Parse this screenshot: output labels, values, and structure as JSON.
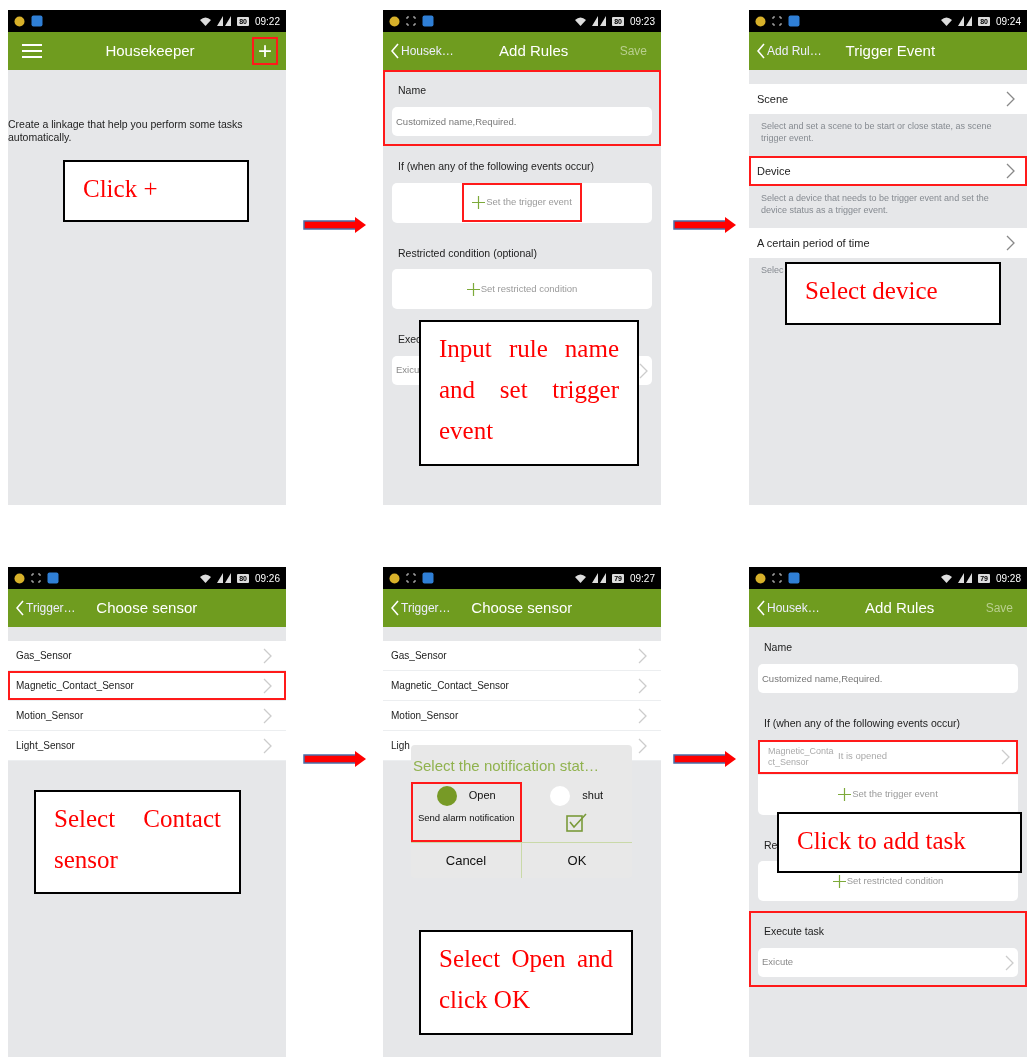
{
  "steps": [
    {
      "status": {
        "time": "09:22",
        "battery": "80"
      },
      "appbar": {
        "menu": true,
        "title": "Housekeeper",
        "action": {
          "label": "+",
          "disabled": false,
          "highlighted": true
        }
      },
      "kind": "intro",
      "text": "Create a linkage that help you perform some tasks automatically.",
      "callout": "Click +"
    },
    {
      "status": {
        "time": "09:23",
        "battery": "80"
      },
      "appbar": {
        "back": "Housek…",
        "title": "Add Rules",
        "action": {
          "label": "Save",
          "disabled": true,
          "highlighted": false
        }
      },
      "kind": "form",
      "sections": [
        {
          "label": "Name",
          "kind": "input",
          "placeholder": "Customized name,Required.",
          "highlighted": true
        },
        {
          "label": "If (when any of the following events occur)",
          "kind": "add",
          "button": {
            "label": "Set the trigger event",
            "highlighted": true
          },
          "highlighted": false
        },
        {
          "label": "Restricted condition (optional)",
          "kind": "add",
          "button": {
            "label": "Set restricted condition",
            "highlighted": false
          },
          "highlighted": false
        },
        {
          "label": "Exec",
          "kind": "select",
          "placeholder": "Exicu",
          "highlighted": false
        }
      ],
      "callout": "Input rule name and set trigger event"
    },
    {
      "status": {
        "time": "09:24",
        "battery": "80"
      },
      "appbar": {
        "back": "Add Rul…",
        "title": "Trigger Event"
      },
      "kind": "options",
      "options": [
        {
          "label": "Scene",
          "description": "Select and set a scene to be start or close state, as scene trigger event.",
          "highlighted": false
        },
        {
          "label": "Device",
          "description": "Select a device that needs to be trigger event and set the device status as a trigger event.",
          "highlighted": true
        },
        {
          "label": "A certain period of time",
          "description": "Selec",
          "highlighted": false
        }
      ],
      "callout": "Select device"
    },
    {
      "status": {
        "time": "09:26",
        "battery": "80"
      },
      "appbar": {
        "back": "Trigger…",
        "title": "Choose sensor"
      },
      "kind": "list",
      "items": [
        {
          "label": "Gas_Sensor",
          "highlighted": false
        },
        {
          "label": "Magnetic_Contact_Sensor",
          "highlighted": true
        },
        {
          "label": "Motion_Sensor",
          "highlighted": false
        },
        {
          "label": "Light_Sensor",
          "highlighted": false
        }
      ],
      "callout": "Select Contact sensor"
    },
    {
      "status": {
        "time": "09:27",
        "battery": "79"
      },
      "appbar": {
        "back": "Trigger…",
        "title": "Choose sensor"
      },
      "kind": "list",
      "items": [
        {
          "label": "Gas_Sensor",
          "highlighted": false
        },
        {
          "label": "Magnetic_Contact_Sensor",
          "highlighted": false
        },
        {
          "label": "Motion_Sensor",
          "highlighted": false
        },
        {
          "label": "Ligh",
          "highlighted": false
        }
      ],
      "dialog": {
        "title": "Select the notification stat…",
        "options": [
          {
            "label": "Open",
            "selected": true,
            "note": "Send alarm notification",
            "highlighted": true
          },
          {
            "label": "shut",
            "selected": false,
            "checked": true,
            "highlighted": false
          }
        ],
        "buttons": [
          "Cancel",
          "OK"
        ]
      },
      "callout": "Select Open and click OK"
    },
    {
      "status": {
        "time": "09:28",
        "battery": "79"
      },
      "appbar": {
        "back": "Housek…",
        "title": "Add Rules",
        "action": {
          "label": "Save",
          "disabled": true,
          "highlighted": false
        }
      },
      "kind": "form",
      "sections": [
        {
          "label": "Name",
          "kind": "input",
          "placeholder": "Customized name,Required.",
          "highlighted": false
        },
        {
          "label": "If (when any of the following events occur)",
          "kind": "add",
          "items": [
            {
              "device": "Magnetic_Contact_Sensor",
              "state": "It is opened",
              "highlighted": true
            }
          ],
          "button": {
            "label": "Set the trigger event",
            "highlighted": false
          },
          "highlighted": false
        },
        {
          "label": "Re",
          "kind": "add",
          "button": {
            "label": "Set restricted condition",
            "highlighted": false
          },
          "highlighted": false
        },
        {
          "label": "Execute task",
          "kind": "select",
          "placeholder": "Exicute",
          "highlighted": true
        }
      ],
      "callout": "Click to add task"
    }
  ]
}
